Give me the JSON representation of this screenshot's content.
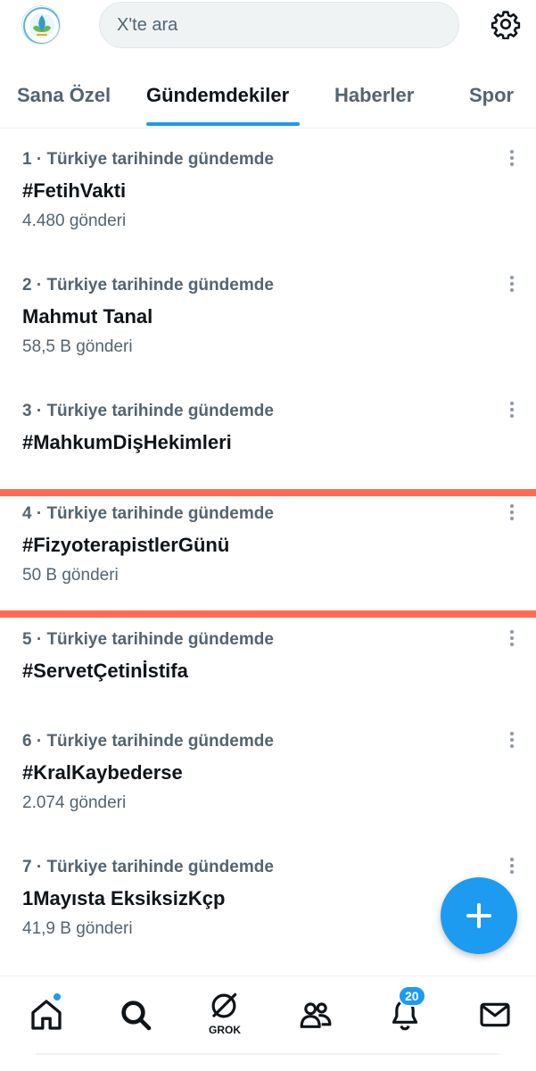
{
  "header": {
    "search_placeholder": "X'te ara"
  },
  "tabs": [
    {
      "label": "Sana Özel",
      "active": false
    },
    {
      "label": "Gündemdekiler",
      "active": true
    },
    {
      "label": "Haberler",
      "active": false
    },
    {
      "label": "Spor",
      "active": false
    }
  ],
  "trends": [
    {
      "meta": "1 · Türkiye tarihinde gündemde",
      "title": "#FetihVakti",
      "count": "4.480 gönderi"
    },
    {
      "meta": "2 · Türkiye tarihinde gündemde",
      "title": "Mahmut Tanal",
      "count": "58,5 B gönderi"
    },
    {
      "meta": "3 · Türkiye tarihinde gündemde",
      "title": "#MahkumDişHekimleri",
      "count": ""
    },
    {
      "meta": "4 · Türkiye tarihinde gündemde",
      "title": "#FizyoterapistlerGünü",
      "count": "50 B gönderi"
    },
    {
      "meta": "5 · Türkiye tarihinde gündemde",
      "title": "#ServetÇetinİstifa",
      "count": ""
    },
    {
      "meta": "6 · Türkiye tarihinde gündemde",
      "title": "#KralKaybederse",
      "count": "2.074 gönderi"
    },
    {
      "meta": "7 · Türkiye tarihinde gündemde",
      "title": "1Mayısta EksiksizKçp",
      "count": "41,9 B gönderi"
    }
  ],
  "bottom_nav": {
    "grok_label": "GROK",
    "notifications_badge": "20",
    "icons": [
      "home-icon",
      "search-icon",
      "grok-icon",
      "communities-icon",
      "notifications-icon",
      "messages-icon"
    ]
  },
  "colors": {
    "accent": "#1d9bf0",
    "highlight": "#ff6a55",
    "secondary_text": "#536471"
  }
}
